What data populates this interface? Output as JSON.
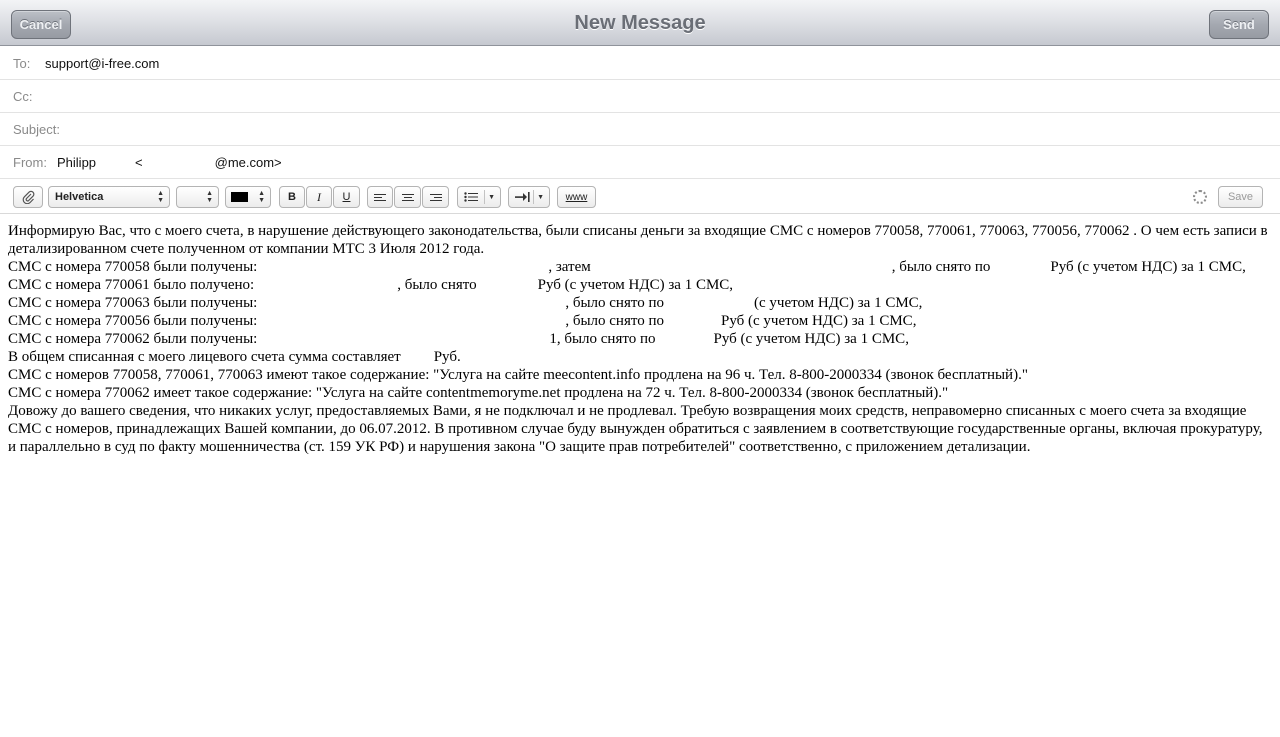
{
  "titlebar": {
    "cancel_label": "Cancel",
    "title": "New Message",
    "send_label": "Send"
  },
  "header": {
    "to": {
      "label": "To:",
      "value": "support@i-free.com"
    },
    "cc": {
      "label": "Cc:",
      "value": ""
    },
    "subject": {
      "label": "Subject:",
      "value": ""
    },
    "from": {
      "label": "From:",
      "name": "Philipp",
      "open": "<",
      "domain": "@me.com>"
    }
  },
  "toolbar": {
    "attach_icon": "paperclip-icon",
    "font_value": "Helvetica",
    "size_value": "",
    "text_color": "#000000",
    "bold_label": "B",
    "italic_label": "I",
    "underline_label": "U",
    "link_label": "www",
    "save_label": "Save"
  },
  "message": {
    "line1": "Информирую Вас, что с моего счета, в нарушение действующего законодательства, были списаны деньги за входящие СМС с номеров 770058, 770061, 770063, 770056, 770062 . О чем есть записи в детализированном счете полученном от компании МТС 3 Июля 2012 года.",
    "line2_a": "СМС с номера 770058 были получены:",
    "line2_b": ", затем",
    "line2_c": ", было снято по",
    "line2_d": "Руб (с учетом НДС) за 1 СМС,",
    "line3_a": "СМС с номера 770061 было получено:",
    "line3_b": ", было снято",
    "line3_c": "Руб (с учетом НДС) за 1 СМС,",
    "line4_a": "СМС с номера 770063 были получены:",
    "line4_b": ", было снято по",
    "line4_c": "(с учетом НДС) за 1 СМС,",
    "line5_a": "СМС с номера 770056 были получены:",
    "line5_b": ", было снято по",
    "line5_c": "Руб (с учетом НДС) за 1 СМС,",
    "line6_a": "СМС с номера 770062 были получены:",
    "line6_b": "1, было снято по",
    "line6_c": "Руб (с учетом НДС) за 1 СМС,",
    "line7_a": "В общем списанная с моего лицевого счета сумма составляет",
    "line7_b": "Руб.",
    "line8": "СМС с номеров 770058, 770061, 770063 имеют такое содержание: \"Услуга на сайте meecontent.info продлена на 96 ч. Тел. 8-800-2000334 (звонок бесплатный).\"",
    "line9": "СМС с номера 770062 имеет такое содержание: \"Услуга на сайте contentmemoryme.net продлена на 72 ч. Тел. 8-800-2000334 (звонок бесплатный).\"",
    "line10": "Довожу до вашего сведения, что никаких услуг, предоставляемых Вами, я не подключал и не продлевал. Требую возвращения моих средств, неправомерно списанных с моего счета за входящие СМС с номеров, принадлежащих Вашей компании, до 06.07.2012. В противном случае буду вынужден обратиться с заявлением в соответствующие государственные органы, включая прокуратуру, и параллельно в суд по факту мошенничества (ст. 159 УК РФ) и нарушения закона \"О защите прав потребителей\" соответственно, с приложением детализации."
  }
}
